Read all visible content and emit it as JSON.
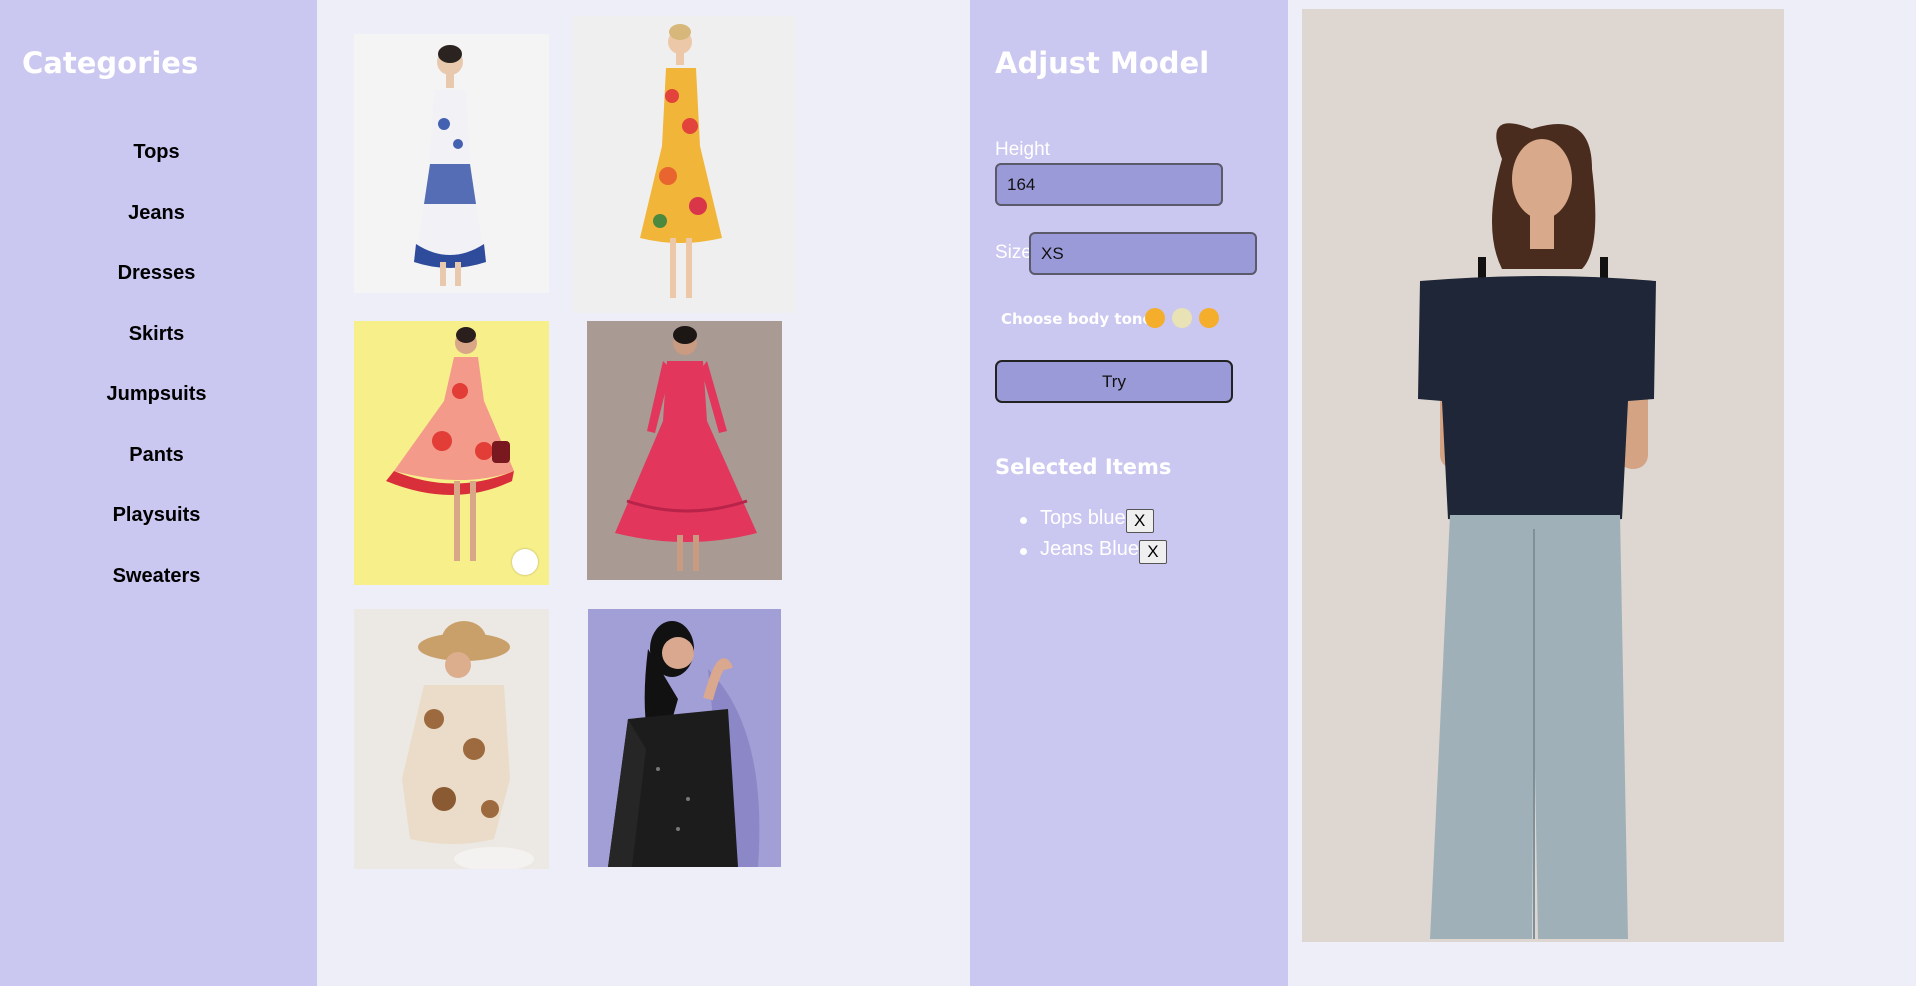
{
  "sidebar": {
    "title": "Categories",
    "items": [
      {
        "label": "Tops"
      },
      {
        "label": "Jeans"
      },
      {
        "label": "Dresses"
      },
      {
        "label": "Skirts"
      },
      {
        "label": "Jumpsuits"
      },
      {
        "label": "Pants"
      },
      {
        "label": "Playsuits"
      },
      {
        "label": "Sweaters"
      }
    ]
  },
  "products": [
    {
      "name": "blue-floral-print-dress",
      "colors": [
        "#f4f4f4",
        "#3550a3"
      ]
    },
    {
      "name": "yellow-red-floral-dress",
      "colors": [
        "#f0efef",
        "#e8a030"
      ]
    },
    {
      "name": "red-floral-ruffle-dress",
      "colors": [
        "#f7ef8a",
        "#e0463a"
      ]
    },
    {
      "name": "pink-tiered-midi-dress",
      "colors": [
        "#a99a94",
        "#e2365c"
      ]
    },
    {
      "name": "brown-floral-backless-dress",
      "colors": [
        "#ece8e4",
        "#9c6a3e"
      ]
    },
    {
      "name": "black-sequin-one-shoulder-dress",
      "colors": [
        "#a29fd6",
        "#1c1c1c"
      ]
    }
  ],
  "adjust": {
    "title": "Adjust Model",
    "height_label": "Height",
    "height_value": "164",
    "size_label": "Size",
    "size_value": "XS",
    "tone_label": "Choose body tone",
    "tones": [
      "#f4ae2c",
      "#e8e2b4",
      "#f4ae2c"
    ],
    "try_label": "Try"
  },
  "selected": {
    "title": "Selected Items",
    "items": [
      {
        "label": "Tops blue",
        "remove_label": "X"
      },
      {
        "label": "Jeans Blue",
        "remove_label": "X"
      }
    ]
  },
  "preview": {
    "background": "#ded6d0",
    "top_color": "#1e2637",
    "jeans_color": "#9fb0b8"
  }
}
